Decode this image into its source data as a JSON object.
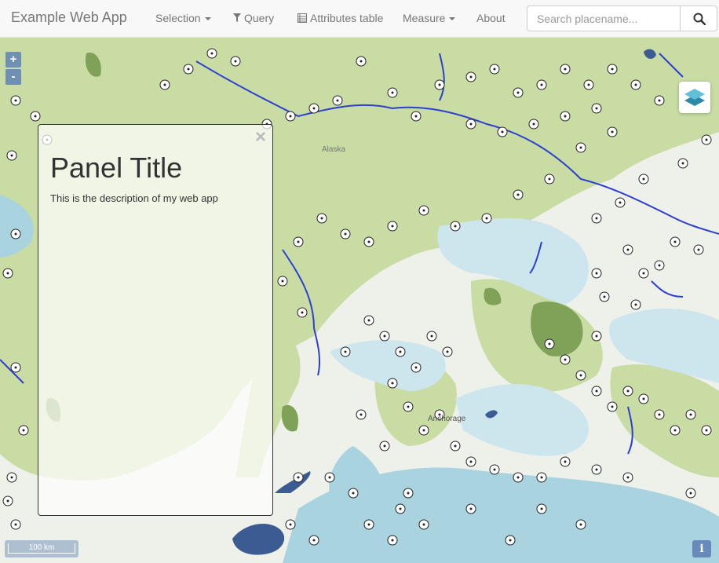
{
  "app": {
    "brand": "Example Web App",
    "colors": {
      "navbar": "#f8f8f8",
      "accent": "#6082b6",
      "water": "#a9d3df",
      "forest": "#c8dca4",
      "river": "#2c3fd1"
    }
  },
  "nav": {
    "selection": "Selection",
    "query": "Query",
    "attributes": "Attributes table",
    "measure": "Measure",
    "about": "About"
  },
  "search": {
    "placeholder": "Search placename...",
    "icon": "search-icon"
  },
  "map": {
    "zoom_in": "+",
    "zoom_out": "-",
    "layer_switcher_icon": "layers-icon",
    "info": "i",
    "scale_label": "100 km",
    "place_labels": [
      "Alaska",
      "Anchorage"
    ]
  },
  "panel": {
    "title": "Panel Title",
    "description": "This is the description of my web app",
    "close": "×"
  }
}
